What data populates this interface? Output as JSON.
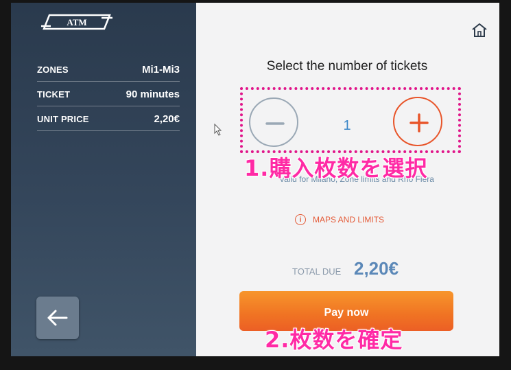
{
  "brand": {
    "logo_text": "ATM"
  },
  "summary": {
    "rows": [
      {
        "label": "ZONES",
        "value": "Mi1-Mi3"
      },
      {
        "label": "TICKET",
        "value": "90 minutes"
      },
      {
        "label": "UNIT PRICE",
        "value": "2,20€"
      }
    ]
  },
  "main": {
    "title": "Select the number of tickets",
    "quantity": "1",
    "partial_text": "Valid for Milano, Zone limits and Rho Fiera",
    "maps_link": "MAPS AND LIMITS",
    "total_label": "TOTAL DUE",
    "total_value": "2,20€",
    "pay_label": "Pay now"
  },
  "annotations": {
    "step1": "1.購入枚数を選択",
    "step2": "2.枚数を確定"
  },
  "colors": {
    "accent_orange": "#f07323",
    "annotation_pink": "#ff2aa5",
    "quantity_blue": "#3a86c7",
    "panel_dark": "#2a3a4d"
  }
}
